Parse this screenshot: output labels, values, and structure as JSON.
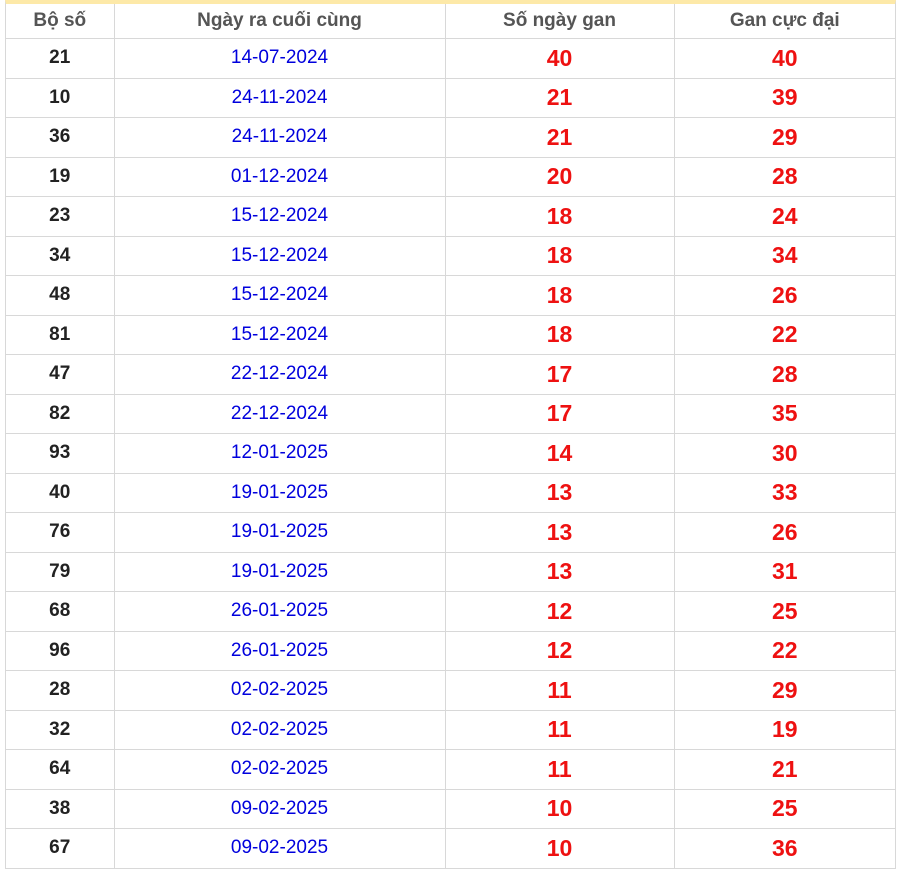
{
  "table": {
    "headers": [
      "Bộ số",
      "Ngày ra cuối cùng",
      "Số ngày gan",
      "Gan cực đại"
    ],
    "rows": [
      {
        "number": "21",
        "last_date": "14-07-2024",
        "gan_days": "40",
        "max_gan": "40"
      },
      {
        "number": "10",
        "last_date": "24-11-2024",
        "gan_days": "21",
        "max_gan": "39"
      },
      {
        "number": "36",
        "last_date": "24-11-2024",
        "gan_days": "21",
        "max_gan": "29"
      },
      {
        "number": "19",
        "last_date": "01-12-2024",
        "gan_days": "20",
        "max_gan": "28"
      },
      {
        "number": "23",
        "last_date": "15-12-2024",
        "gan_days": "18",
        "max_gan": "24"
      },
      {
        "number": "34",
        "last_date": "15-12-2024",
        "gan_days": "18",
        "max_gan": "34"
      },
      {
        "number": "48",
        "last_date": "15-12-2024",
        "gan_days": "18",
        "max_gan": "26"
      },
      {
        "number": "81",
        "last_date": "15-12-2024",
        "gan_days": "18",
        "max_gan": "22"
      },
      {
        "number": "47",
        "last_date": "22-12-2024",
        "gan_days": "17",
        "max_gan": "28"
      },
      {
        "number": "82",
        "last_date": "22-12-2024",
        "gan_days": "17",
        "max_gan": "35"
      },
      {
        "number": "93",
        "last_date": "12-01-2025",
        "gan_days": "14",
        "max_gan": "30"
      },
      {
        "number": "40",
        "last_date": "19-01-2025",
        "gan_days": "13",
        "max_gan": "33"
      },
      {
        "number": "76",
        "last_date": "19-01-2025",
        "gan_days": "13",
        "max_gan": "26"
      },
      {
        "number": "79",
        "last_date": "19-01-2025",
        "gan_days": "13",
        "max_gan": "31"
      },
      {
        "number": "68",
        "last_date": "26-01-2025",
        "gan_days": "12",
        "max_gan": "25"
      },
      {
        "number": "96",
        "last_date": "26-01-2025",
        "gan_days": "12",
        "max_gan": "22"
      },
      {
        "number": "28",
        "last_date": "02-02-2025",
        "gan_days": "11",
        "max_gan": "29"
      },
      {
        "number": "32",
        "last_date": "02-02-2025",
        "gan_days": "11",
        "max_gan": "19"
      },
      {
        "number": "64",
        "last_date": "02-02-2025",
        "gan_days": "11",
        "max_gan": "21"
      },
      {
        "number": "38",
        "last_date": "09-02-2025",
        "gan_days": "10",
        "max_gan": "25"
      },
      {
        "number": "67",
        "last_date": "09-02-2025",
        "gan_days": "10",
        "max_gan": "36"
      }
    ]
  },
  "colors": {
    "header_text": "#555555",
    "number_text": "#222222",
    "date_text": "#0000dd",
    "gan_text": "#ee1111",
    "top_accent": "#fde9a8",
    "border": "#d8d8d8"
  }
}
